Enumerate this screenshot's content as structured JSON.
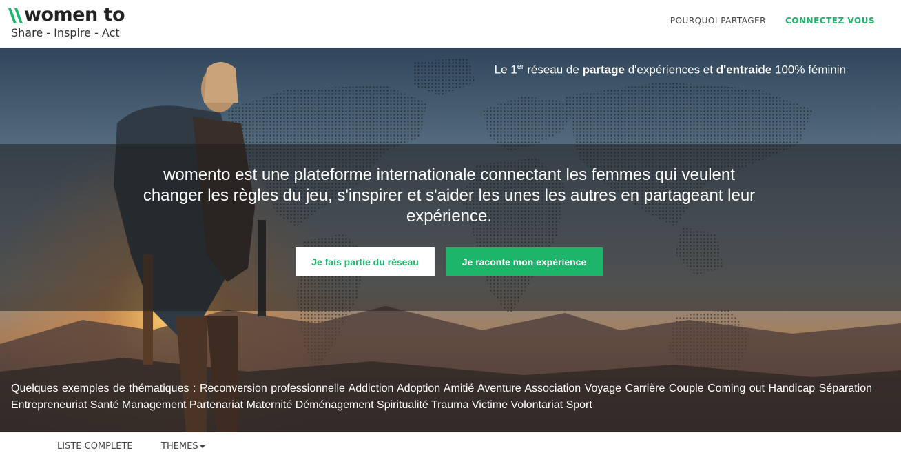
{
  "brand": {
    "wordmark": "women to",
    "tagline": "Share - Inspire - Act",
    "logo_color": "#1db56a"
  },
  "nav": {
    "why_share": "POURQUOI PARTAGER",
    "connect": "CONNECTEZ VOUS"
  },
  "hero": {
    "tagline": {
      "pre": "Le 1",
      "sup": "er",
      "mid1": " réseau de ",
      "bold1": "partage",
      "mid2": " d'expériences et ",
      "bold2": "d'entraide",
      "post": " 100% féminin"
    },
    "lead": "womento est une plateforme internationale connectant les femmes qui veulent changer les règles du jeu, s'inspirer et s'aider les unes les autres en partageant leur expérience.",
    "button_network": "Je fais partie du réseau",
    "button_story": "Je raconte mon expérience",
    "themes_intro": "Quelques exemples de thématiques :",
    "themes": [
      "Reconversion professionnelle",
      "Addiction",
      "Adoption",
      "Amitié",
      "Aventure",
      "Association",
      "Voyage",
      "Carrière",
      "Couple",
      "Coming out",
      "Handicap",
      "Séparation",
      "Entrepreneuriat",
      "Santé",
      "Management",
      "Partenariat",
      "Maternité",
      "Déménagement",
      "Spiritualité",
      "Trauma",
      "Victime",
      "Volontariat",
      "Sport"
    ]
  },
  "subnav": {
    "full_list": "LISTE COMPLETE",
    "themes": "THEMES"
  },
  "colors": {
    "accent": "#1db56a",
    "band": "#1e1e1e"
  }
}
